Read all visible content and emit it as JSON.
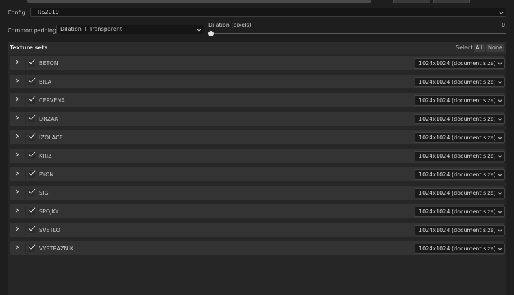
{
  "config": {
    "label": "Config",
    "value": "TRS2019"
  },
  "padding": {
    "label": "Common padding",
    "value": "Dilation + Transparent"
  },
  "dilation": {
    "label": "Dilation (pixels)",
    "value": "0",
    "fraction": 0
  },
  "texture_sets": {
    "title": "Texture sets",
    "select_label": "Select",
    "all_label": "All",
    "none_label": "None",
    "items": [
      {
        "name": "BETON",
        "resolution": "1024x1024 (document size)",
        "checked": true
      },
      {
        "name": "BILA",
        "resolution": "1024x1024 (document size)",
        "checked": true
      },
      {
        "name": "CERVENA",
        "resolution": "1024x1024 (document size)",
        "checked": true
      },
      {
        "name": "DRZAK",
        "resolution": "1024x1024 (document size)",
        "checked": true
      },
      {
        "name": "IZOLACE",
        "resolution": "1024x1024 (document size)",
        "checked": true
      },
      {
        "name": "KRIZ",
        "resolution": "1024x1024 (document size)",
        "checked": true
      },
      {
        "name": "PYON",
        "resolution": "1024x1024 (document size)",
        "checked": true
      },
      {
        "name": "SIG",
        "resolution": "1024x1024 (document size)",
        "checked": true
      },
      {
        "name": "SPOJKY",
        "resolution": "1024x1024 (document size)",
        "checked": true
      },
      {
        "name": "SVETLO",
        "resolution": "1024x1024 (document size)",
        "checked": true
      },
      {
        "name": "VYSTRAZNIK",
        "resolution": "1024x1024 (document size)",
        "checked": true
      }
    ]
  }
}
